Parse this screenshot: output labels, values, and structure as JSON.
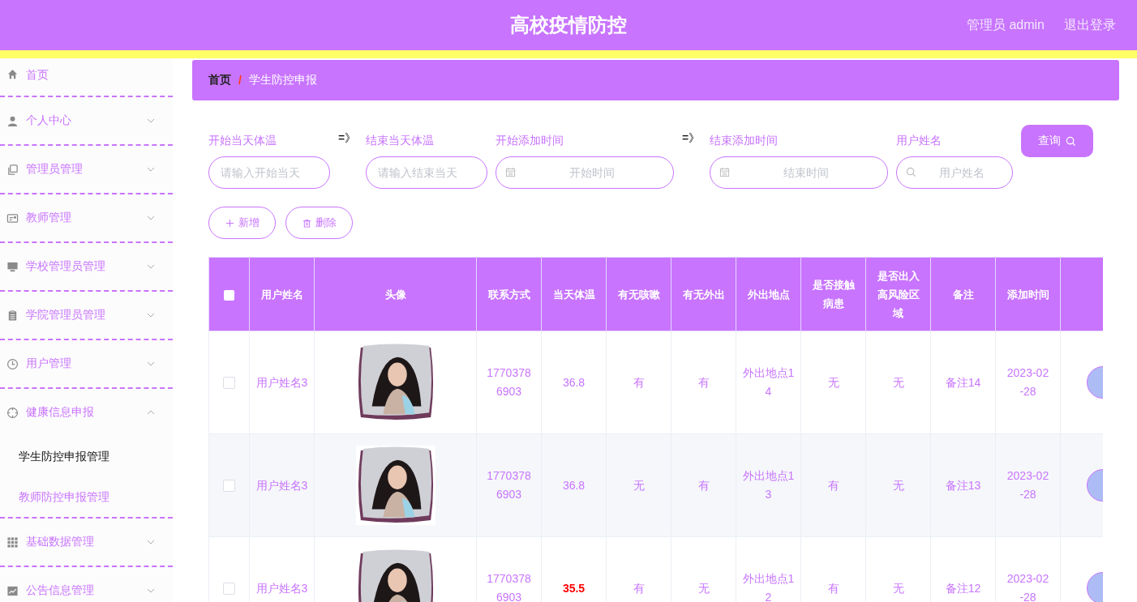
{
  "header": {
    "title": "高校疫情防控",
    "user": "管理员 admin",
    "logout": "退出登录"
  },
  "sidebar": {
    "items": [
      {
        "label": "首页",
        "kind": "link"
      },
      {
        "label": "个人中心",
        "kind": "menu",
        "expanded": false
      },
      {
        "label": "管理员管理",
        "kind": "menu",
        "expanded": false
      },
      {
        "label": "教师管理",
        "kind": "menu",
        "expanded": false
      },
      {
        "label": "学校管理员管理",
        "kind": "menu",
        "expanded": false
      },
      {
        "label": "学院管理员管理",
        "kind": "menu",
        "expanded": false
      },
      {
        "label": "用户管理",
        "kind": "menu",
        "expanded": false
      },
      {
        "label": "健康信息申报",
        "kind": "menu",
        "expanded": true,
        "children": [
          {
            "label": "学生防控申报管理",
            "selected": true
          },
          {
            "label": "教师防控申报管理",
            "selected": false
          }
        ]
      },
      {
        "label": "基础数据管理",
        "kind": "menu",
        "expanded": false
      },
      {
        "label": "公告信息管理",
        "kind": "menu",
        "expanded": false
      }
    ]
  },
  "breadcrumb": [
    "首页",
    "学生防控申报"
  ],
  "breadcrumb_separator": "/",
  "filters": [
    {
      "kind": "text",
      "label": "开始当天体温",
      "placeholder": "请输入开始当天"
    },
    {
      "kind": "separator",
      "text": "=》"
    },
    {
      "kind": "text",
      "label": "结束当天体温",
      "placeholder": "请输入结束当天"
    },
    {
      "kind": "date",
      "label": "开始添加时间",
      "placeholder": "开始时间"
    },
    {
      "kind": "separator",
      "text": "=》"
    },
    {
      "kind": "date",
      "label": "结束添加时间",
      "placeholder": "结束时间"
    },
    {
      "kind": "search",
      "label": "用户姓名",
      "placeholder": "用户姓名"
    }
  ],
  "query_button": "查询",
  "actions": [
    {
      "label": "新增",
      "kind": "add"
    },
    {
      "label": "删除",
      "kind": "delete"
    }
  ],
  "table": {
    "select_all": {
      "checked": false
    },
    "columns": [
      "用户姓名",
      "头像",
      "联系方式",
      "当天体温",
      "有无咳嗽",
      "有无外出",
      "外出地点",
      "是否接触病患",
      "是否出入高风险区域",
      "备注",
      "添加时间"
    ],
    "rows": [
      {
        "selected": false,
        "cells": [
          "用户姓名3",
          {
            "kind": "picture"
          },
          "17703786903",
          "36.8",
          "有",
          "有",
          "外出地点14",
          "无",
          "无",
          "备注14",
          "2023-02-28"
        ],
        "abnormal_temperature": false
      },
      {
        "selected": false,
        "cells": [
          "用户姓名3",
          {
            "kind": "picture"
          },
          "17703786903",
          "36.8",
          "无",
          "有",
          "外出地点13",
          "有",
          "无",
          "备注13",
          "2023-02-28"
        ],
        "abnormal_temperature": false
      },
      {
        "selected": false,
        "cells": [
          "用户姓名3",
          {
            "kind": "picture"
          },
          "17703786903",
          "35.5",
          "有",
          "无",
          "外出地点12",
          "有",
          "无",
          "备注12",
          "2023-02-28"
        ],
        "abnormal_temperature": true
      }
    ]
  }
}
